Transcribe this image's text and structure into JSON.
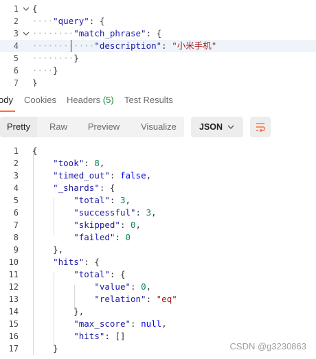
{
  "request_editor": {
    "lines": [
      {
        "n": "1",
        "fold": "v",
        "code": [
          [
            "p",
            "{"
          ]
        ]
      },
      {
        "n": "2",
        "fold": "",
        "code": [
          [
            "ws",
            "····"
          ],
          [
            "k",
            "\"query\""
          ],
          [
            "p",
            ": {"
          ]
        ]
      },
      {
        "n": "3",
        "fold": "v",
        "code": [
          [
            "ws",
            "········"
          ],
          [
            "k",
            "\"match_phrase\""
          ],
          [
            "p",
            ": {"
          ]
        ]
      },
      {
        "n": "4",
        "fold": "",
        "hl": true,
        "code": [
          [
            "ws",
            "············"
          ],
          [
            "k",
            "\"description\""
          ],
          [
            "p",
            ": "
          ],
          [
            "s",
            "\"小米手机\""
          ]
        ]
      },
      {
        "n": "5",
        "fold": "",
        "code": [
          [
            "ws",
            "········"
          ],
          [
            "p",
            "}"
          ]
        ]
      },
      {
        "n": "6",
        "fold": "",
        "code": [
          [
            "ws",
            "····"
          ],
          [
            "p",
            "}"
          ]
        ]
      },
      {
        "n": "7",
        "fold": "",
        "code": [
          [
            "p",
            "}"
          ]
        ]
      }
    ]
  },
  "response_tabs": [
    {
      "label": "Body",
      "display": "ody",
      "active": true
    },
    {
      "label": "Cookies",
      "active": false
    },
    {
      "label": "Headers",
      "count": "(5)",
      "active": false
    },
    {
      "label": "Test Results",
      "active": false
    }
  ],
  "view_modes": [
    "Pretty",
    "Raw",
    "Preview",
    "Visualize"
  ],
  "active_view": "Pretty",
  "format_select": "JSON",
  "response_lines": [
    {
      "n": "1",
      "code": [
        [
          "p",
          "{"
        ]
      ]
    },
    {
      "n": "2",
      "code": [
        [
          "sp",
          "    "
        ],
        [
          "k",
          "\"took\""
        ],
        [
          "p",
          ": "
        ],
        [
          "n",
          "8"
        ],
        [
          "p",
          ","
        ]
      ]
    },
    {
      "n": "3",
      "code": [
        [
          "sp",
          "    "
        ],
        [
          "k",
          "\"timed_out\""
        ],
        [
          "p",
          ": "
        ],
        [
          "kw",
          "false"
        ],
        [
          "p",
          ","
        ]
      ]
    },
    {
      "n": "4",
      "code": [
        [
          "sp",
          "    "
        ],
        [
          "k",
          "\"_shards\""
        ],
        [
          "p",
          ": {"
        ]
      ]
    },
    {
      "n": "5",
      "code": [
        [
          "sp",
          "        "
        ],
        [
          "k",
          "\"total\""
        ],
        [
          "p",
          ": "
        ],
        [
          "n",
          "3"
        ],
        [
          "p",
          ","
        ]
      ]
    },
    {
      "n": "6",
      "code": [
        [
          "sp",
          "        "
        ],
        [
          "k",
          "\"successful\""
        ],
        [
          "p",
          ": "
        ],
        [
          "n",
          "3"
        ],
        [
          "p",
          ","
        ]
      ]
    },
    {
      "n": "7",
      "code": [
        [
          "sp",
          "        "
        ],
        [
          "k",
          "\"skipped\""
        ],
        [
          "p",
          ": "
        ],
        [
          "n",
          "0"
        ],
        [
          "p",
          ","
        ]
      ]
    },
    {
      "n": "8",
      "code": [
        [
          "sp",
          "        "
        ],
        [
          "k",
          "\"failed\""
        ],
        [
          "p",
          ": "
        ],
        [
          "n",
          "0"
        ]
      ]
    },
    {
      "n": "9",
      "code": [
        [
          "sp",
          "    "
        ],
        [
          "p",
          "},"
        ]
      ]
    },
    {
      "n": "10",
      "code": [
        [
          "sp",
          "    "
        ],
        [
          "k",
          "\"hits\""
        ],
        [
          "p",
          ": {"
        ]
      ]
    },
    {
      "n": "11",
      "code": [
        [
          "sp",
          "        "
        ],
        [
          "k",
          "\"total\""
        ],
        [
          "p",
          ": {"
        ]
      ]
    },
    {
      "n": "12",
      "code": [
        [
          "sp",
          "            "
        ],
        [
          "k",
          "\"value\""
        ],
        [
          "p",
          ": "
        ],
        [
          "n",
          "0"
        ],
        [
          "p",
          ","
        ]
      ]
    },
    {
      "n": "13",
      "code": [
        [
          "sp",
          "            "
        ],
        [
          "k",
          "\"relation\""
        ],
        [
          "p",
          ": "
        ],
        [
          "s",
          "\"eq\""
        ]
      ]
    },
    {
      "n": "14",
      "code": [
        [
          "sp",
          "        "
        ],
        [
          "p",
          "},"
        ]
      ]
    },
    {
      "n": "15",
      "code": [
        [
          "sp",
          "        "
        ],
        [
          "k",
          "\"max_score\""
        ],
        [
          "p",
          ": "
        ],
        [
          "kw",
          "null"
        ],
        [
          "p",
          ","
        ]
      ]
    },
    {
      "n": "16",
      "code": [
        [
          "sp",
          "        "
        ],
        [
          "k",
          "\"hits\""
        ],
        [
          "p",
          ": []"
        ]
      ]
    },
    {
      "n": "17",
      "code": [
        [
          "sp",
          "    "
        ],
        [
          "p",
          "}"
        ]
      ]
    }
  ],
  "watermark": "CSDN @g3230863",
  "colors": {
    "accent": "#ff6c37",
    "key": "#1a1aa6",
    "string": "#a31515",
    "number": "#098658",
    "keyword": "#0000ff"
  }
}
